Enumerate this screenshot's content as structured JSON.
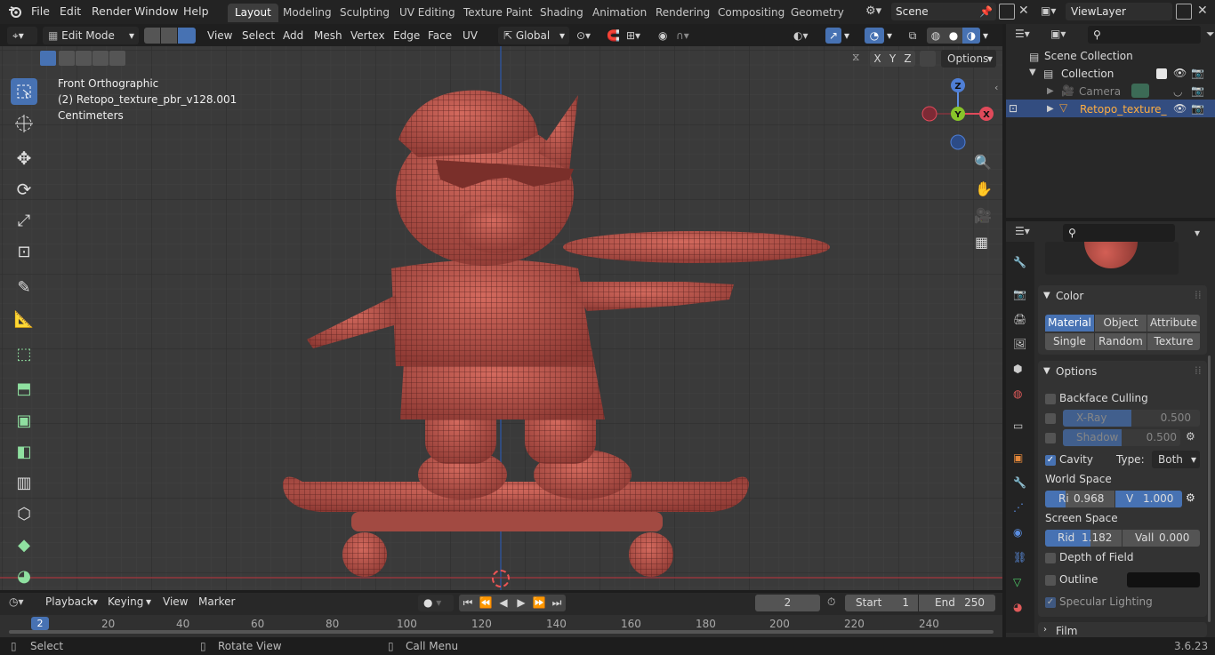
{
  "menus": [
    "File",
    "Edit",
    "Render",
    "Window",
    "Help"
  ],
  "workspaces": [
    "Layout",
    "Modeling",
    "Sculpting",
    "UV Editing",
    "Texture Paint",
    "Shading",
    "Animation",
    "Rendering",
    "Compositing",
    "Geometry Noc"
  ],
  "scene": {
    "label": "Scene",
    "viewlayer": "ViewLayer"
  },
  "header": {
    "mode": "Edit Mode",
    "menus": [
      "View",
      "Select",
      "Add",
      "Mesh",
      "Vertex",
      "Edge",
      "Face",
      "UV"
    ],
    "orientation": "Global",
    "options": "Options",
    "axes": [
      "X",
      "Y",
      "Z"
    ]
  },
  "viewport": {
    "view_name": "Front Orthographic",
    "object_info": "(2) Retopo_texture_pbr_v128.001",
    "units": "Centimeters"
  },
  "gizmo": {
    "z": "Z",
    "y": "Y",
    "x": "X"
  },
  "outliner": {
    "scene_collection": "Scene Collection",
    "collection": "Collection",
    "camera": "Camera",
    "object": "Retopo_texture_"
  },
  "properties": {
    "color_title": "Color",
    "color_options": [
      "Material",
      "Object",
      "Attribute",
      "Single",
      "Random",
      "Texture"
    ],
    "options_title": "Options",
    "backface": "Backface Culling",
    "xray": {
      "label": "X-Ray",
      "value": "0.500"
    },
    "shadow": {
      "label": "Shadow",
      "value": "0.500"
    },
    "cavity": "Cavity",
    "type_label": "Type:",
    "type_value": "Both",
    "world_space": "World Space",
    "ws_ridge": {
      "label": "Ri",
      "value": "0.968"
    },
    "ws_valley": {
      "label": "V",
      "value": "1.000"
    },
    "screen_space": "Screen Space",
    "ss_ridge": {
      "label": "Rid",
      "value": "1.182"
    },
    "ss_valley": {
      "label": "Vall",
      "value": "0.000"
    },
    "dof": "Depth of Field",
    "outline": "Outline",
    "specular": "Specular Lighting",
    "film": "Film"
  },
  "timeline": {
    "playback": "Playback",
    "keying": "Keying",
    "view": "View",
    "marker": "Marker",
    "current_frame": "2",
    "start_label": "Start",
    "start": "1",
    "end_label": "End",
    "end": "250",
    "ruler": [
      "2",
      "20",
      "40",
      "60",
      "80",
      "100",
      "120",
      "140",
      "160",
      "180",
      "200",
      "220",
      "240"
    ]
  },
  "status": {
    "select": "Select",
    "rotate": "Rotate View",
    "call_menu": "Call Menu",
    "version": "3.6.23"
  }
}
